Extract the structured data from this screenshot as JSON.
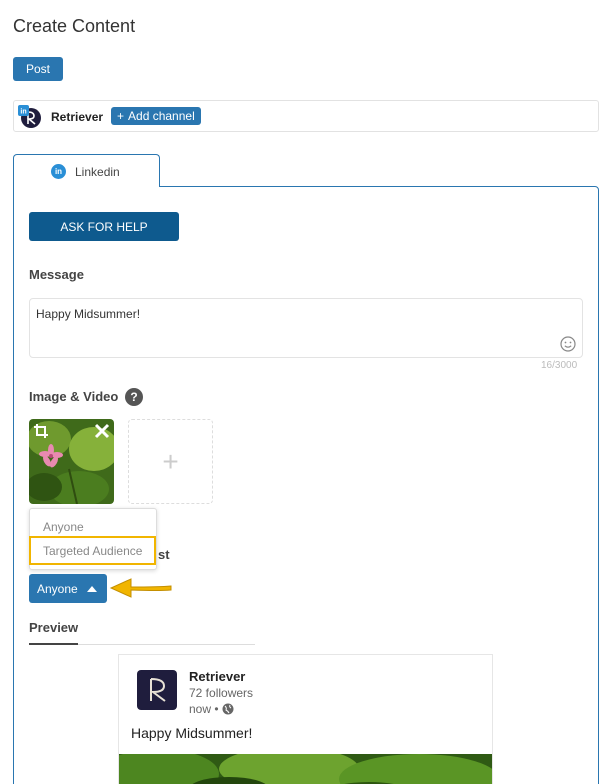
{
  "page": {
    "title": "Create Content"
  },
  "post_button": {
    "label": "Post"
  },
  "channels": {
    "name": "Retriever",
    "add_label": "Add channel",
    "add_icon": "plus-icon"
  },
  "tab": {
    "label": "Linkedin",
    "icon": "linkedin-icon"
  },
  "help_button": {
    "label": "ASK FOR HELP"
  },
  "message": {
    "section_label": "Message",
    "value": "Happy Midsummer!",
    "char_count": "16/3000",
    "emoji_icon": "smiley-icon"
  },
  "media": {
    "section_label": "Image & Video",
    "help_icon": "question-icon",
    "thumb_icons": [
      "crop-icon",
      "close-icon"
    ],
    "add_icon": "plus-icon"
  },
  "visibility": {
    "label_partial": "st",
    "options": [
      "Anyone",
      "Targeted Audience"
    ],
    "selected": "Anyone",
    "highlight_color": "#f1b500"
  },
  "preview": {
    "tab_label": "Preview",
    "card": {
      "name": "Retriever",
      "followers": "72 followers",
      "time": "now •",
      "message": "Happy Midsummer!"
    }
  },
  "colors": {
    "primary": "#2a76b0",
    "help_button": "#0e5a8e",
    "annotation": "#f1b500"
  }
}
